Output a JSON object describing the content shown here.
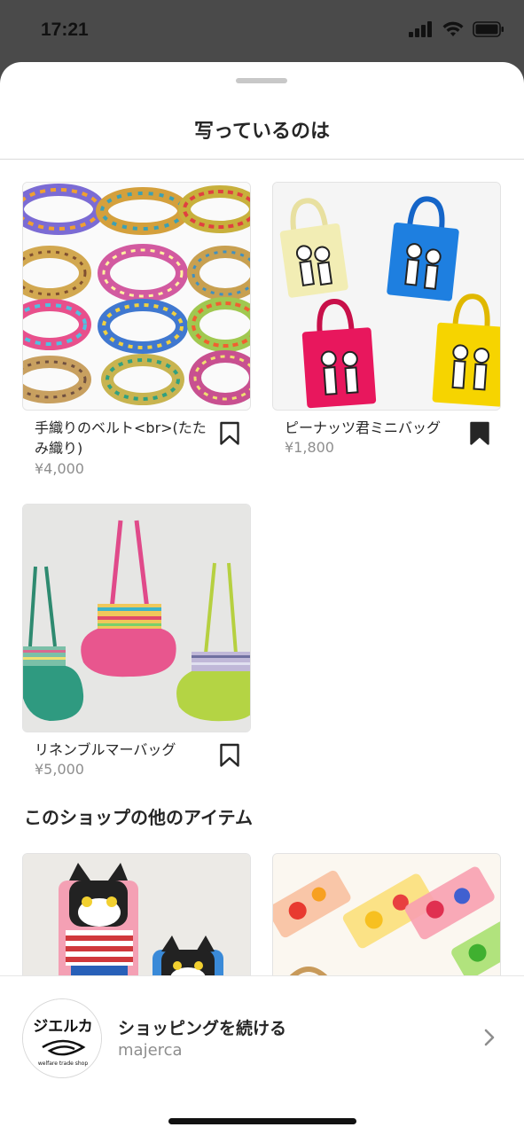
{
  "status_bar": {
    "time": "17:21"
  },
  "sheet": {
    "title": "写っているのは"
  },
  "products": [
    {
      "name": "手織りのベルト<br>(たたみ織り)",
      "price": "¥4,000",
      "saved": false
    },
    {
      "name": "ピーナッツ君ミニバッグ",
      "price": "¥1,800",
      "saved": true
    },
    {
      "name": "リネンブルマーバッグ",
      "price": "¥5,000",
      "saved": false
    }
  ],
  "more_section": {
    "title": "このショップの他のアイテム"
  },
  "shop_bar": {
    "cta": "ショッピングを続ける",
    "shop_name": "majerca",
    "logo_text": "ジエルカ",
    "logo_subtext": "welfare trade shop"
  },
  "colors": {
    "accent_pink": "#e8175d",
    "accent_blue": "#1e7fe0",
    "accent_yellow": "#f6d400",
    "text_primary": "#262626",
    "text_secondary": "#8e8e8e"
  }
}
